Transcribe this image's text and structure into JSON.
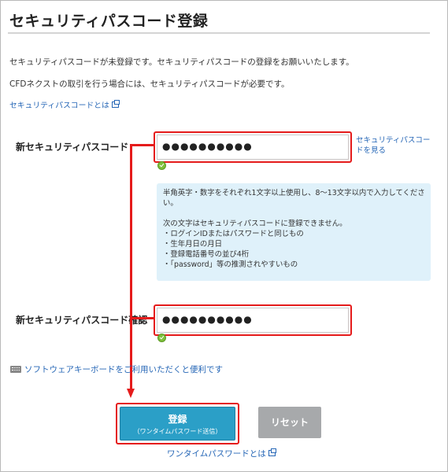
{
  "page": {
    "title": "セキュリティパスコード登録",
    "intro1": "セキュリティパスコードが未登録です。セキュリティパスコードの登録をお願いいたします。",
    "intro2": "CFDネクストの取引を行う場合には、セキュリティパスコードが必要です。",
    "about_link": "セキュリティパスコードとは"
  },
  "form": {
    "new_label": "新セキュリティパスコード",
    "new_value": "●●●●●●●●●●",
    "show_link_line1": "セキュリティパスコー",
    "show_link_line2": "ドを見る",
    "confirm_label": "新セキュリティパスコード確認",
    "confirm_value": "●●●●●●●●●●"
  },
  "hint": {
    "line1": "半角英字・数字をそれぞれ1文字以上使用し、8〜13文字以内で入力してくださ",
    "line2": "い。",
    "line3": "次の文字はセキュリティパスコードに登録できません。",
    "items": [
      "・ログインIDまたはパスワードと同じもの",
      "・生年月日の月日",
      "・登録電話番号の並び4桁",
      "・「password」等の推測されやすいもの"
    ]
  },
  "keyboard_link": "ソフトウェアキーボードをご利用いただくと便利です",
  "buttons": {
    "register_label": "登録",
    "register_sub": "（ワンタイムパスワード送信）",
    "reset_label": "リセット"
  },
  "otp_link": "ワンタイムパスワードとは",
  "colors": {
    "accent_red": "#e51b1b",
    "primary_button": "#2b9fc7",
    "reset_button": "#a7a9ab",
    "link": "#2566b6",
    "hint_bg": "#dff1fa"
  }
}
